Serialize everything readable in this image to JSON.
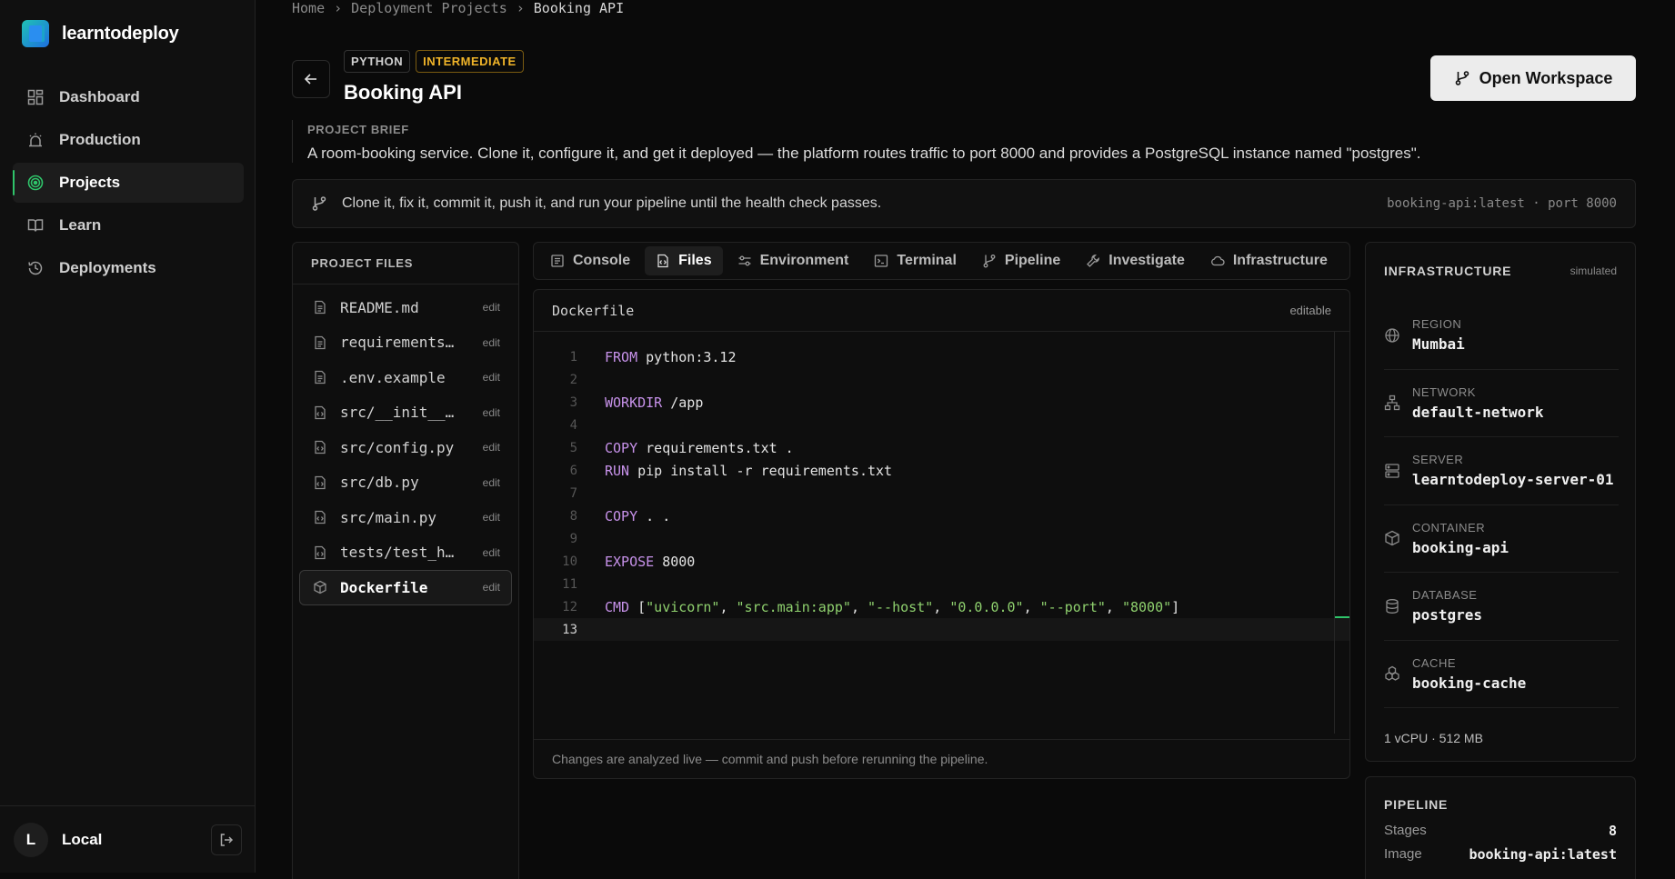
{
  "brand": {
    "name": "learntodeploy"
  },
  "sidebar": {
    "items": [
      {
        "label": "Dashboard",
        "icon": "grid-icon"
      },
      {
        "label": "Production",
        "icon": "alarm-icon"
      },
      {
        "label": "Projects",
        "icon": "target-icon",
        "active": true
      },
      {
        "label": "Learn",
        "icon": "book-icon"
      },
      {
        "label": "Deployments",
        "icon": "history-icon"
      }
    ],
    "user": {
      "initial": "L",
      "name": "Local"
    }
  },
  "breadcrumb": [
    "Home",
    "Deployment Projects",
    "Booking API"
  ],
  "project": {
    "badges": [
      "PYTHON",
      "INTERMEDIATE"
    ],
    "title": "Booking API",
    "open_button": "Open Workspace",
    "brief_label": "PROJECT BRIEF",
    "brief_text": "A room-booking service. Clone it, configure it, and get it deployed — the platform routes traffic to port 8000 and provides a PostgreSQL instance named \"postgres\"."
  },
  "hint": {
    "text": "Clone it, fix it, commit it, push it, and run your pipeline until the health check passes.",
    "meta": "booking-api:latest · port 8000"
  },
  "files_panel": {
    "title": "PROJECT FILES",
    "edit_label": "edit",
    "files": [
      {
        "name": "README.md",
        "icon": "document-icon"
      },
      {
        "name": "requirements.txt",
        "icon": "document-icon"
      },
      {
        "name": ".env.example",
        "icon": "document-icon"
      },
      {
        "name": "src/__init__.py",
        "icon": "code-file-icon"
      },
      {
        "name": "src/config.py",
        "icon": "code-file-icon"
      },
      {
        "name": "src/db.py",
        "icon": "code-file-icon"
      },
      {
        "name": "src/main.py",
        "icon": "code-file-icon"
      },
      {
        "name": "tests/test_health.py",
        "icon": "code-file-icon"
      },
      {
        "name": "Dockerfile",
        "icon": "container-icon",
        "active": true
      }
    ]
  },
  "tabs": [
    {
      "label": "Console",
      "icon": "console-icon"
    },
    {
      "label": "Files",
      "icon": "files-icon",
      "active": true
    },
    {
      "label": "Environment",
      "icon": "sliders-icon"
    },
    {
      "label": "Terminal",
      "icon": "terminal-icon"
    },
    {
      "label": "Pipeline",
      "icon": "branch-icon"
    },
    {
      "label": "Investigate",
      "icon": "wrench-icon"
    },
    {
      "label": "Infrastructure",
      "icon": "cloud-icon"
    }
  ],
  "editor": {
    "filename": "Dockerfile",
    "tag": "editable",
    "current_line": 13,
    "lines": [
      [
        {
          "t": "FROM",
          "k": "kw"
        },
        {
          "t": " python:3.12"
        }
      ],
      [],
      [
        {
          "t": "WORKDIR",
          "k": "kw"
        },
        {
          "t": " /app"
        }
      ],
      [],
      [
        {
          "t": "COPY",
          "k": "kw"
        },
        {
          "t": " requirements.txt ."
        }
      ],
      [
        {
          "t": "RUN",
          "k": "kw"
        },
        {
          "t": " pip install -r requirements.txt"
        }
      ],
      [],
      [
        {
          "t": "COPY",
          "k": "kw"
        },
        {
          "t": " . ."
        }
      ],
      [],
      [
        {
          "t": "EXPOSE",
          "k": "kw"
        },
        {
          "t": " 8000"
        }
      ],
      [],
      [
        {
          "t": "CMD",
          "k": "kw"
        },
        {
          "t": " ["
        },
        {
          "t": "\"uvicorn\"",
          "k": "st"
        },
        {
          "t": ", "
        },
        {
          "t": "\"src.main:app\"",
          "k": "st"
        },
        {
          "t": ", "
        },
        {
          "t": "\"--host\"",
          "k": "st"
        },
        {
          "t": ", "
        },
        {
          "t": "\"0.0.0.0\"",
          "k": "st"
        },
        {
          "t": ", "
        },
        {
          "t": "\"--port\"",
          "k": "st"
        },
        {
          "t": ", "
        },
        {
          "t": "\"8000\"",
          "k": "st"
        },
        {
          "t": "]"
        }
      ],
      []
    ],
    "footer": "Changes are analyzed live — commit and push before rerunning the pipeline."
  },
  "infrastructure": {
    "title": "INFRASTRUCTURE",
    "tag": "simulated",
    "rows": [
      {
        "label": "REGION",
        "value": "Mumbai",
        "icon": "globe-icon"
      },
      {
        "label": "NETWORK",
        "value": "default-network",
        "icon": "network-icon"
      },
      {
        "label": "SERVER",
        "value": "learntodeploy-server-01",
        "icon": "server-icon"
      },
      {
        "label": "CONTAINER",
        "value": "booking-api",
        "icon": "box-icon"
      },
      {
        "label": "DATABASE",
        "value": "postgres",
        "icon": "database-icon"
      },
      {
        "label": "CACHE",
        "value": "booking-cache",
        "icon": "cache-icon"
      }
    ],
    "footer": "1 vCPU · 512 MB"
  },
  "pipeline": {
    "title": "PIPELINE",
    "rows": [
      {
        "label": "Stages",
        "value": "8"
      },
      {
        "label": "Image",
        "value": "booking-api:latest"
      }
    ]
  },
  "colors": {
    "accent": "#2fc46a",
    "warning": "#f0b429",
    "keyword": "#c792ea",
    "string": "#8fd16e"
  }
}
